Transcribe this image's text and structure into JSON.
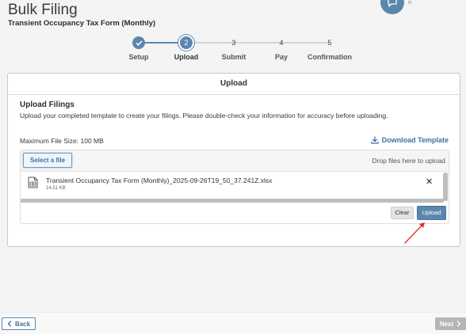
{
  "page": {
    "title": "Bulk Filing",
    "subtitle": "Transient Occupancy Tax Form (Monthly)"
  },
  "stepper": {
    "steps": [
      {
        "number": "1",
        "label": "Setup",
        "state": "done"
      },
      {
        "number": "2",
        "label": "Upload",
        "state": "active"
      },
      {
        "number": "3",
        "label": "Submit",
        "state": "pending"
      },
      {
        "number": "4",
        "label": "Pay",
        "state": "pending"
      },
      {
        "number": "5",
        "label": "Confirmation",
        "state": "pending"
      }
    ]
  },
  "card": {
    "header": "Upload",
    "section_title": "Upload Filings",
    "section_desc": "Upload your completed template to create your filings. Please double-check your information for accuracy before uploading.",
    "max_size": "Maximum File Size: 100 MB",
    "download_label": "Download Template"
  },
  "upload": {
    "select_label": "Select a file",
    "drop_text": "Drop files here to upload",
    "file_name": "Transient Occupancy Tax Form (Monthly)_2025-09-26T19_50_37.241Z.xlsx",
    "file_size": "14.51 KB",
    "remove_glyph": "✕",
    "clear_label": "Clear",
    "upload_label": "Upload"
  },
  "footer": {
    "back_label": "Back",
    "next_label": "Next"
  },
  "colors": {
    "accent": "#5b87ad",
    "link": "#3f73a3",
    "annotation_arrow": "#e0301e",
    "disabled": "#b5b5b5"
  },
  "icons": {
    "chat": "chat-bubble-icon",
    "check": "check-icon",
    "download": "download-icon",
    "file": "spreadsheet-file-icon",
    "back": "chevron-left-icon",
    "next": "chevron-right-icon"
  }
}
